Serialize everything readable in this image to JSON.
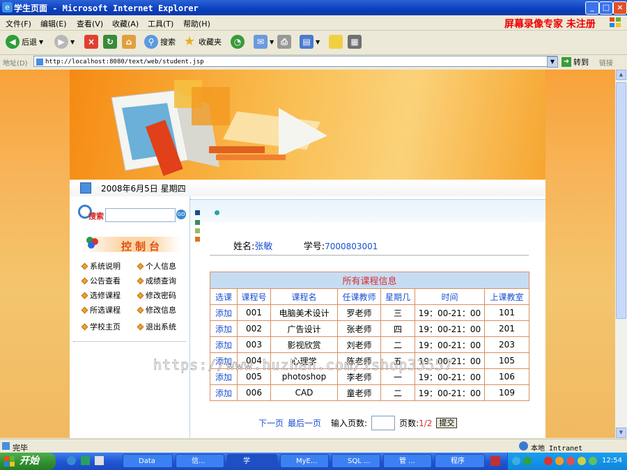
{
  "window": {
    "title": "学生页面 - Microsoft Internet Explorer",
    "recorder_text": "屏幕录像专家  未注册"
  },
  "menu": [
    "文件(F)",
    "编辑(E)",
    "查看(V)",
    "收藏(A)",
    "工具(T)",
    "帮助(H)"
  ],
  "toolbar": {
    "back": "后退",
    "search": "搜索",
    "favorites": "收藏夹"
  },
  "address": {
    "label": "地址(D)",
    "url": "http://localhost:8080/text/web/student.jsp",
    "go": "转到",
    "links": "链接"
  },
  "page": {
    "date": "2008年6月5日 星期四",
    "search_label": "搜索",
    "search_go": "GO",
    "console_title": "控制台",
    "nav_left": [
      "系统说明",
      "公告查看",
      "选修课程",
      "所选课程",
      "学校主页"
    ],
    "nav_right": [
      "个人信息",
      "成绩查询",
      "修改密码",
      "修改信息",
      "退出系统"
    ],
    "student": {
      "name_label": "姓名:",
      "name": "张敏",
      "id_label": "学号:",
      "id": "7000803001"
    },
    "table": {
      "caption": "所有课程信息",
      "headers": [
        "选课",
        "课程号",
        "课程名",
        "任课教师",
        "星期几",
        "时间",
        "上课教室"
      ],
      "rows": [
        [
          "添加",
          "001",
          "电脑美术设计",
          "罗老师",
          "三",
          "19：00-21：00",
          "101"
        ],
        [
          "添加",
          "002",
          "广告设计",
          "张老师",
          "四",
          "19：00-21：00",
          "201"
        ],
        [
          "添加",
          "003",
          "影视欣赏",
          "刘老师",
          "二",
          "19：00-21：00",
          "203"
        ],
        [
          "添加",
          "004",
          "心理学",
          "陈老师",
          "五",
          "19：00-21：00",
          "105"
        ],
        [
          "添加",
          "005",
          "photoshop",
          "李老师",
          "一",
          "19：00-21：00",
          "106"
        ],
        [
          "添加",
          "006",
          "CAD",
          "童老师",
          "二",
          "19：00-21：00",
          "109"
        ]
      ]
    },
    "pager": {
      "next": "下一页",
      "last": "最后一页",
      "input_label": "输入页数:",
      "page_label": "页数:",
      "page_value": "1/2",
      "submit": "提交"
    }
  },
  "watermark": "https://www.huzhan.com/ishop33557",
  "status": {
    "text": "完毕",
    "zone": "本地 Intranet"
  },
  "taskbar": {
    "start": "开始",
    "tasks": [
      "Data",
      "信...",
      "学",
      "MyE...",
      "SQL ...",
      "管 ...",
      "程序"
    ],
    "clock": "12:54"
  }
}
